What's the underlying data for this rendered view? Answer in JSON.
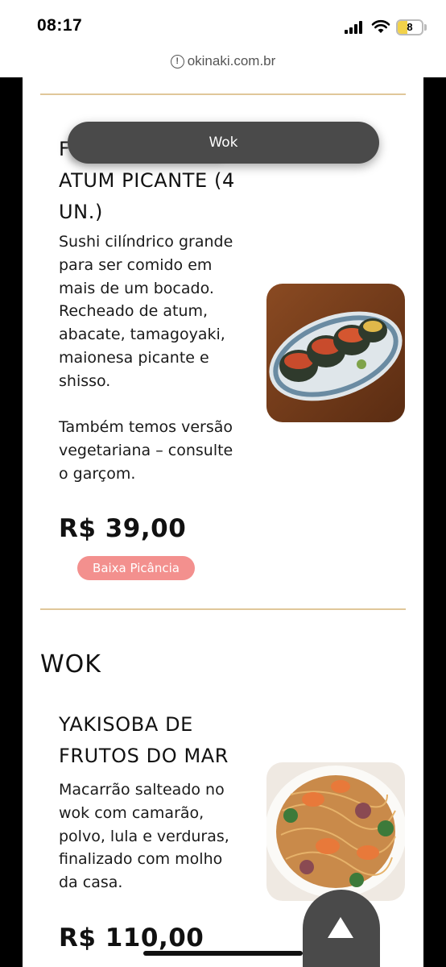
{
  "status_bar": {
    "time": "08:17",
    "battery": "8"
  },
  "url_bar": {
    "domain": "okinaki.com.br",
    "icon": "info-icon"
  },
  "toast": {
    "label": "Wok"
  },
  "item1": {
    "title_line1_prefix": "F",
    "title_line2": "ATUM PICANTE (4",
    "title_line3": "UN.)",
    "description": [
      "Sushi cilíndrico grande",
      "para ser comido em",
      "mais de um bocado.",
      "Recheado de atum,",
      "abacate, tamagoyaki,",
      "maionesa picante e",
      "shisso.",
      "",
      "Também temos versão",
      "vegetariana – consulte",
      "o garçom."
    ],
    "price": "R$ 39,00",
    "badge": "Baixa Picância"
  },
  "section": {
    "title": "WOK"
  },
  "item2": {
    "title_line1": "YAKISOBA DE",
    "title_line2": "FRUTOS DO MAR",
    "description": [
      "Macarrão salteado no",
      "wok com camarão,",
      "polvo, lula e verduras,",
      "finalizado com molho",
      "da casa."
    ],
    "price": "R$ 110,00"
  },
  "colors": {
    "divider": "#e0c79a",
    "badge": "#f3908e",
    "toast": "#4a4a4a"
  }
}
